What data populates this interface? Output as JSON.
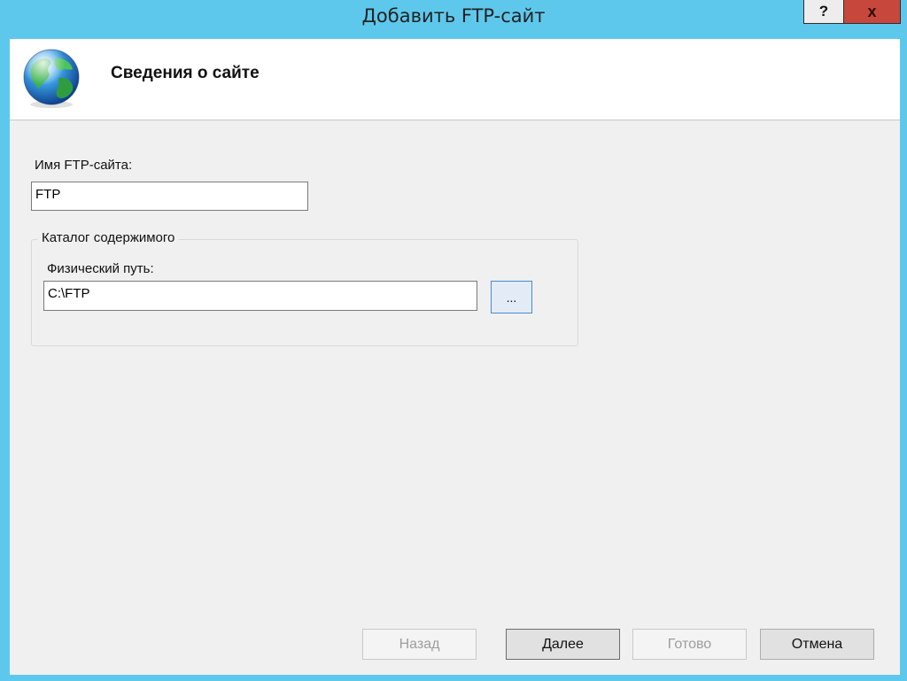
{
  "window": {
    "title": "Добавить FTP-сайт",
    "help_label": "?",
    "close_label": "x"
  },
  "header": {
    "title": "Сведения о сайте",
    "icon": "globe-icon"
  },
  "form": {
    "site_name_label": "Имя FTP-сайта:",
    "site_name_value": "FTP",
    "content_group_label": "Каталог содержимого",
    "physical_path_label": "Физический путь:",
    "physical_path_value": "C:\\FTP",
    "browse_label": "..."
  },
  "buttons": {
    "back": "Назад",
    "next": "Далее",
    "finish": "Готово",
    "cancel": "Отмена"
  },
  "colors": {
    "frame": "#5ec8ec",
    "close_button": "#c8473d",
    "header_background": "#ffffff",
    "client_background": "#f0f0f0"
  }
}
